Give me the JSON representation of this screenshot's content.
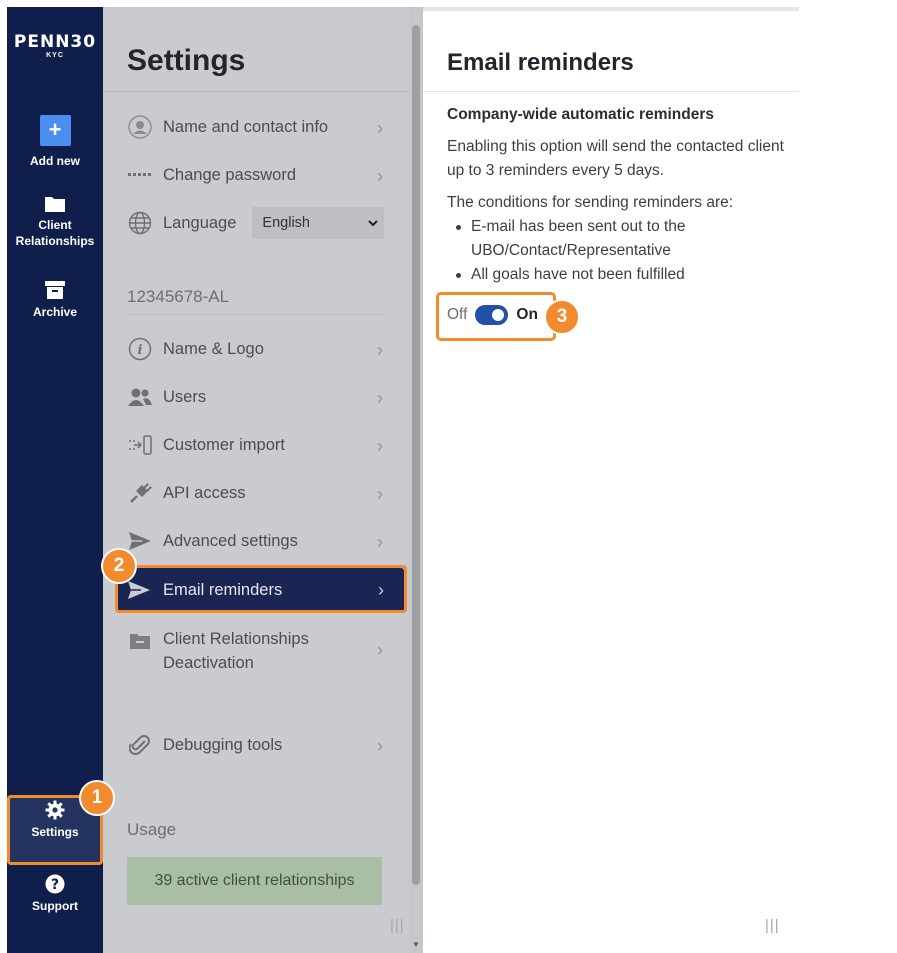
{
  "nav": {
    "logo_brand": "PENN30",
    "logo_sub": "KYC",
    "items": [
      {
        "label": "Add new",
        "icon": "plus-icon"
      },
      {
        "label": "Client\nRelationships",
        "icon": "folder-icon"
      },
      {
        "label": "Archive",
        "icon": "archive-icon"
      }
    ],
    "settings_label": "Settings",
    "support_label": "Support"
  },
  "settings": {
    "title": "Settings",
    "personal_items": [
      {
        "label": "Name and contact info",
        "icon": "user-icon"
      },
      {
        "label": "Change password",
        "icon": "password-dots-icon"
      }
    ],
    "language_label": "Language",
    "language_value": "English",
    "company_id": "12345678-AL",
    "company_items": [
      {
        "label": "Name & Logo",
        "icon": "info-icon"
      },
      {
        "label": "Users",
        "icon": "users-icon"
      },
      {
        "label": "Customer import",
        "icon": "import-icon"
      },
      {
        "label": "API access",
        "icon": "plug-icon"
      },
      {
        "label": "Advanced settings",
        "icon": "send-icon"
      },
      {
        "label": "Email reminders",
        "icon": "send-icon"
      },
      {
        "label": "Client Relationships Deactivation",
        "line1": "Client Relationships",
        "line2": "Deactivation",
        "icon": "folder-minus-icon"
      },
      {
        "label": "Debugging tools",
        "icon": "paperclip-icon"
      }
    ],
    "usage_title": "Usage",
    "usage_text": "39 active client relationships"
  },
  "panel": {
    "title": "Email reminders",
    "subheading": "Company-wide automatic reminders",
    "description": "Enabling this option will send the contacted client up to 3 reminders every 5 days.",
    "conditions_intro": "The conditions for sending reminders are:",
    "conditions": [
      "E-mail has been sent out to the UBO/Contact/Representative",
      "All goals have not been fulfilled"
    ],
    "toggle_off_label": "Off",
    "toggle_on_label": "On",
    "toggle_state": "on"
  },
  "annotations": {
    "badge_1": "1",
    "badge_2": "2",
    "badge_3": "3",
    "color": "#f28a2e"
  },
  "colors": {
    "nav_bg": "#0f1e4a",
    "accent_blue": "#4a8ff0",
    "active_row": "#1b2553",
    "toggle_on": "#2450a8"
  }
}
